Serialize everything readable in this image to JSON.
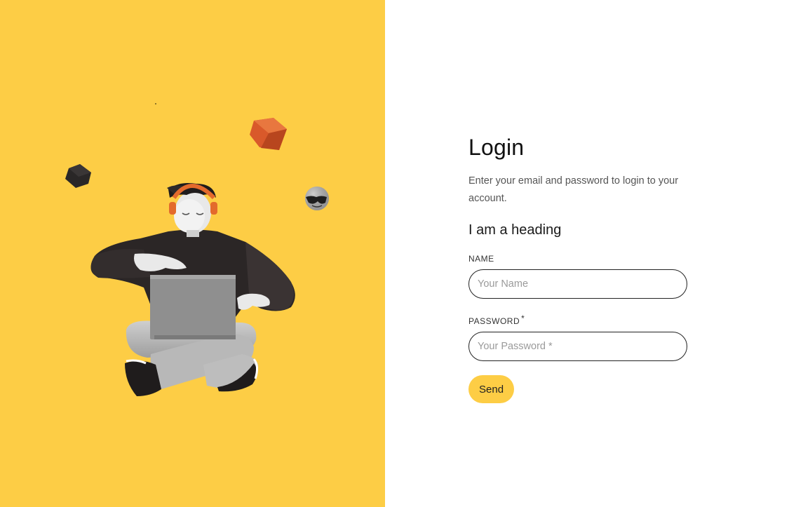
{
  "login": {
    "title": "Login",
    "subtitle": "Enter your email and password to login to your account.",
    "heading": "I am a heading",
    "name_label": "NAME",
    "name_placeholder": "Your Name",
    "password_label": "PASSWORD",
    "password_required_mark": "*",
    "password_placeholder": "Your Password *",
    "send_label": "Send"
  },
  "colors": {
    "accent": "#FDCD45",
    "text": "#111111",
    "muted": "#555555"
  },
  "illustration": {
    "icons": [
      "person-with-laptop-illustration",
      "orange-cube-icon",
      "black-cube-icon",
      "sunglasses-emoji-icon"
    ]
  }
}
